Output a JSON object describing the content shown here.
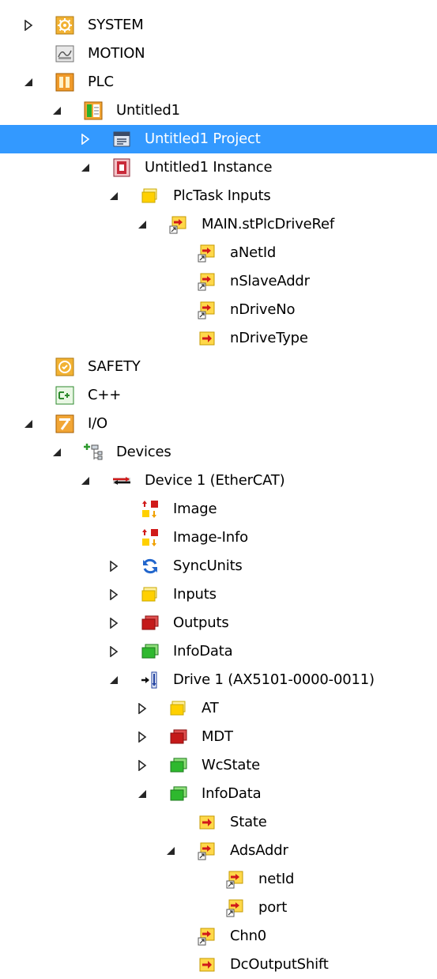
{
  "tree": [
    {
      "id": "system",
      "label": "SYSTEM",
      "icon": "system-gear-icon",
      "level": 0,
      "toggle": "collapsed"
    },
    {
      "id": "motion",
      "label": "MOTION",
      "icon": "motion-icon",
      "level": 0,
      "toggle": "none"
    },
    {
      "id": "plc",
      "label": "PLC",
      "icon": "plc-icon",
      "level": 0,
      "toggle": "expanded"
    },
    {
      "id": "untitled1",
      "label": "Untitled1",
      "icon": "plc-project-icon",
      "level": 1,
      "toggle": "expanded"
    },
    {
      "id": "untitled1-project",
      "label": "Untitled1 Project",
      "icon": "project-file-icon",
      "level": 2,
      "toggle": "collapsed",
      "selected": true
    },
    {
      "id": "untitled1-instance",
      "label": "Untitled1 Instance",
      "icon": "instance-icon",
      "level": 2,
      "toggle": "expanded"
    },
    {
      "id": "plctask-inputs",
      "label": "PlcTask Inputs",
      "icon": "folder-yellow-icon",
      "level": 3,
      "toggle": "expanded"
    },
    {
      "id": "main-stplcdriveref",
      "label": "MAIN.stPlcDriveRef",
      "icon": "input-variable-linked-icon",
      "level": 4,
      "toggle": "expanded"
    },
    {
      "id": "anetid",
      "label": "aNetId",
      "icon": "input-variable-linked-icon",
      "level": 5,
      "toggle": "none"
    },
    {
      "id": "nslaveaddr",
      "label": "nSlaveAddr",
      "icon": "input-variable-linked-icon",
      "level": 5,
      "toggle": "none"
    },
    {
      "id": "ndriveno",
      "label": "nDriveNo",
      "icon": "input-variable-linked-icon",
      "level": 5,
      "toggle": "none"
    },
    {
      "id": "ndrivetype",
      "label": "nDriveType",
      "icon": "input-variable-icon",
      "level": 5,
      "toggle": "none"
    },
    {
      "id": "safety",
      "label": "SAFETY",
      "icon": "safety-icon",
      "level": 0,
      "toggle": "none"
    },
    {
      "id": "cpp",
      "label": "C++",
      "icon": "cpp-icon",
      "level": 0,
      "toggle": "none"
    },
    {
      "id": "io",
      "label": "I/O",
      "icon": "io-icon",
      "level": 0,
      "toggle": "expanded"
    },
    {
      "id": "devices",
      "label": "Devices",
      "icon": "devices-icon",
      "level": 1,
      "toggle": "expanded"
    },
    {
      "id": "device1",
      "label": "Device 1 (EtherCAT)",
      "icon": "ethercat-device-icon",
      "level": 2,
      "toggle": "expanded"
    },
    {
      "id": "image",
      "label": "Image",
      "icon": "image-icon",
      "level": 3,
      "toggle": "none"
    },
    {
      "id": "image-info",
      "label": "Image-Info",
      "icon": "image-icon",
      "level": 3,
      "toggle": "none"
    },
    {
      "id": "syncunits",
      "label": "SyncUnits",
      "icon": "sync-icon",
      "level": 3,
      "toggle": "collapsed"
    },
    {
      "id": "inputs",
      "label": "Inputs",
      "icon": "folder-yellow-icon",
      "level": 3,
      "toggle": "collapsed"
    },
    {
      "id": "outputs",
      "label": "Outputs",
      "icon": "folder-red-icon",
      "level": 3,
      "toggle": "collapsed"
    },
    {
      "id": "infodata",
      "label": "InfoData",
      "icon": "folder-green-icon",
      "level": 3,
      "toggle": "collapsed"
    },
    {
      "id": "drive1",
      "label": "Drive 1 (AX5101-0000-0011)",
      "icon": "drive-icon",
      "level": 3,
      "toggle": "expanded"
    },
    {
      "id": "at",
      "label": "AT",
      "icon": "folder-yellow-icon",
      "level": 4,
      "toggle": "collapsed"
    },
    {
      "id": "mdt",
      "label": "MDT",
      "icon": "folder-red-icon",
      "level": 4,
      "toggle": "collapsed"
    },
    {
      "id": "wcstate",
      "label": "WcState",
      "icon": "folder-green-icon",
      "level": 4,
      "toggle": "collapsed"
    },
    {
      "id": "drive-infodata",
      "label": "InfoData",
      "icon": "folder-green-icon",
      "level": 4,
      "toggle": "expanded"
    },
    {
      "id": "state",
      "label": "State",
      "icon": "input-variable-icon",
      "level": 5,
      "toggle": "none"
    },
    {
      "id": "adsaddr",
      "label": "AdsAddr",
      "icon": "input-variable-linked-icon",
      "level": 5,
      "toggle": "expanded"
    },
    {
      "id": "netid",
      "label": "netId",
      "icon": "input-variable-linked-icon",
      "level": 6,
      "toggle": "none"
    },
    {
      "id": "port",
      "label": "port",
      "icon": "input-variable-linked-icon",
      "level": 6,
      "toggle": "none"
    },
    {
      "id": "chn0",
      "label": "Chn0",
      "icon": "input-variable-linked-icon",
      "level": 5,
      "toggle": "none"
    },
    {
      "id": "dcoutputshift",
      "label": "DcOutputShift",
      "icon": "input-variable-icon",
      "level": 5,
      "toggle": "none"
    }
  ],
  "colors": {
    "selection": "#3399ff",
    "text": "#000000",
    "selected_text": "#ffffff",
    "toggle_arrow": "#262626"
  }
}
